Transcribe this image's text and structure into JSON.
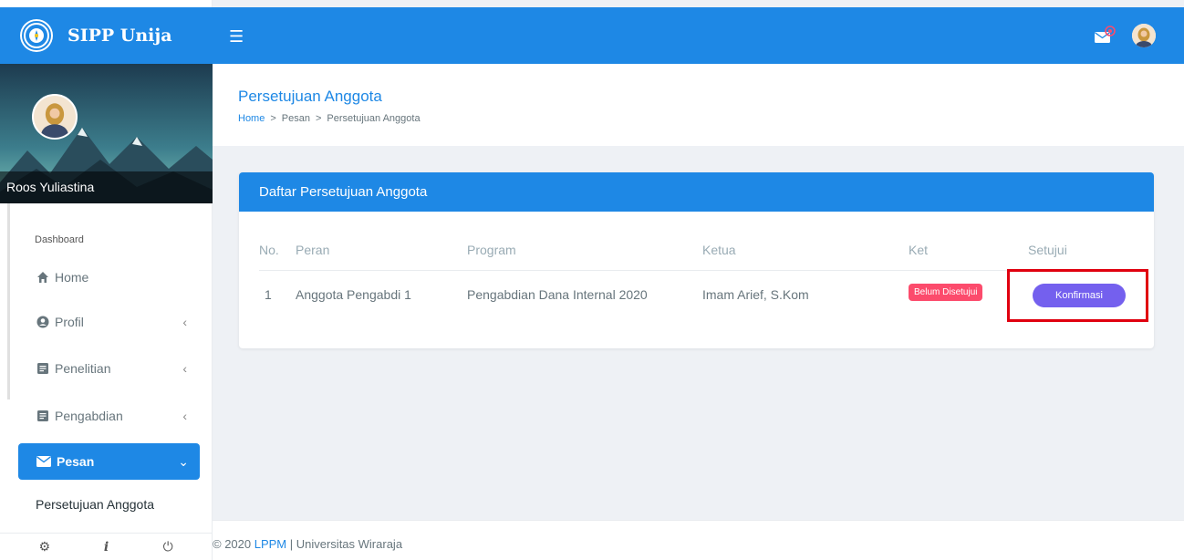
{
  "brand": {
    "name": "SIPP Unija"
  },
  "user": {
    "name": "Roos Yuliastina"
  },
  "sidebar": {
    "caption": "Dashboard",
    "items": [
      {
        "label": "Home",
        "icon": "home-icon"
      },
      {
        "label": "Profil",
        "icon": "user-circle-icon"
      },
      {
        "label": "Penelitian",
        "icon": "document-icon"
      },
      {
        "label": "Pengabdian",
        "icon": "document-icon"
      },
      {
        "label": "Pesan",
        "icon": "envelope-icon"
      }
    ],
    "sub_items": [
      {
        "label": "Persetujuan Anggota"
      }
    ],
    "footer_icons": [
      "settings-icon",
      "info-icon",
      "power-icon"
    ]
  },
  "page": {
    "title": "Persetujuan Anggota",
    "breadcrumb": [
      "Home",
      "Pesan",
      "Persetujuan Anggota"
    ]
  },
  "card": {
    "title": "Daftar Persetujuan Anggota",
    "columns": [
      "No.",
      "Peran",
      "Program",
      "Ketua",
      "Ket",
      "Setujui"
    ],
    "rows": [
      {
        "no": "1",
        "peran": "Anggota Pengabdi 1",
        "program": "Pengabdian Dana Internal 2020",
        "ketua": "Imam Arief, S.Kom",
        "ket": "Belum Disetujui",
        "action": "Konfirmasi"
      }
    ]
  },
  "footer": {
    "prefix": "© 2020 ",
    "link": "LPPM",
    "suffix": " | Universitas Wiraraja"
  },
  "colors": {
    "primary": "#1e88e5",
    "danger": "#fc4b6c",
    "purple": "#7460ee",
    "highlight": "#e0000f"
  }
}
